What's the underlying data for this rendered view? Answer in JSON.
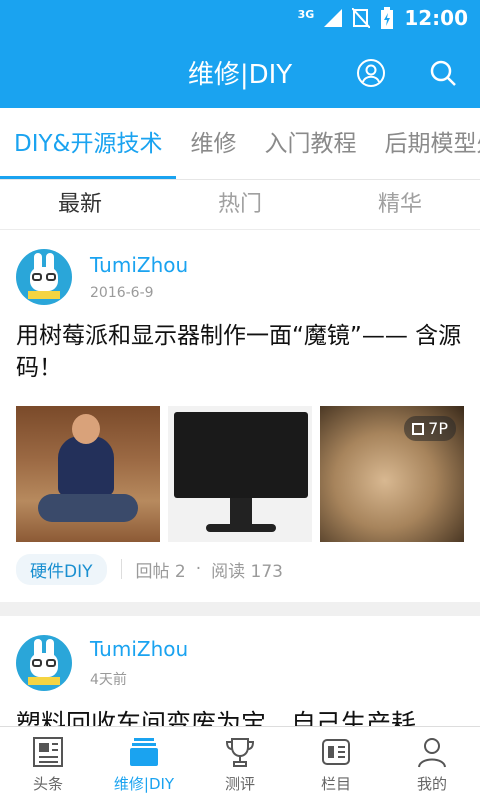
{
  "status": {
    "network": "3G",
    "time": "12:00"
  },
  "header": {
    "title": "维修|DIY"
  },
  "tabs": [
    {
      "label": "DIY&开源技术"
    },
    {
      "label": "维修"
    },
    {
      "label": "入门教程"
    },
    {
      "label": "后期模型处理"
    }
  ],
  "subtabs": [
    {
      "label": "最新"
    },
    {
      "label": "热门"
    },
    {
      "label": "精华"
    }
  ],
  "posts": [
    {
      "author": "TumiZhou",
      "time": "2016-6-9",
      "title": "用树莓派和显示器制作一面“魔镜”—— 含源码！",
      "image_count": "7P",
      "tag": "硬件DIY",
      "replies": "回帖 2",
      "reads": "阅读 173"
    },
    {
      "author": "TumiZhou",
      "time": "4天前",
      "title": "塑料回收车间变废为宝，自己生产耗"
    }
  ],
  "bottom_nav": [
    {
      "label": "头条",
      "icon": "newspaper-icon"
    },
    {
      "label": "维修|DIY",
      "icon": "layers-icon"
    },
    {
      "label": "测评",
      "icon": "trophy-icon"
    },
    {
      "label": "栏目",
      "icon": "column-icon"
    },
    {
      "label": "我的",
      "icon": "person-icon"
    }
  ],
  "colors": {
    "accent": "#1aa3f0"
  }
}
